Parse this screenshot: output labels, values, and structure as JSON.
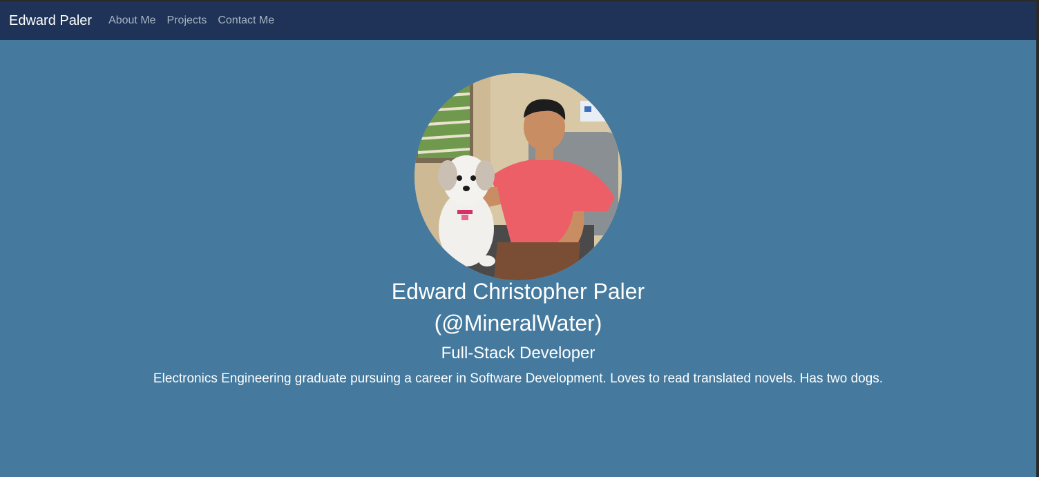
{
  "nav": {
    "brand": "Edward Paler",
    "links": [
      "About Me",
      "Projects",
      "Contact Me"
    ]
  },
  "profile": {
    "image": "profile-photo-man-with-dog",
    "name": "Edward Christopher Paler",
    "handle": "(@MineralWater)",
    "role": "Full-Stack Developer",
    "bio": "Electronics Engineering graduate pursuing a career in Software Development. Loves to read translated novels. Has two dogs."
  },
  "colors": {
    "navbar": "#1e3357",
    "hero_background": "#457a9e",
    "text": "#ffffff",
    "nav_link": "#a9b4c4"
  }
}
